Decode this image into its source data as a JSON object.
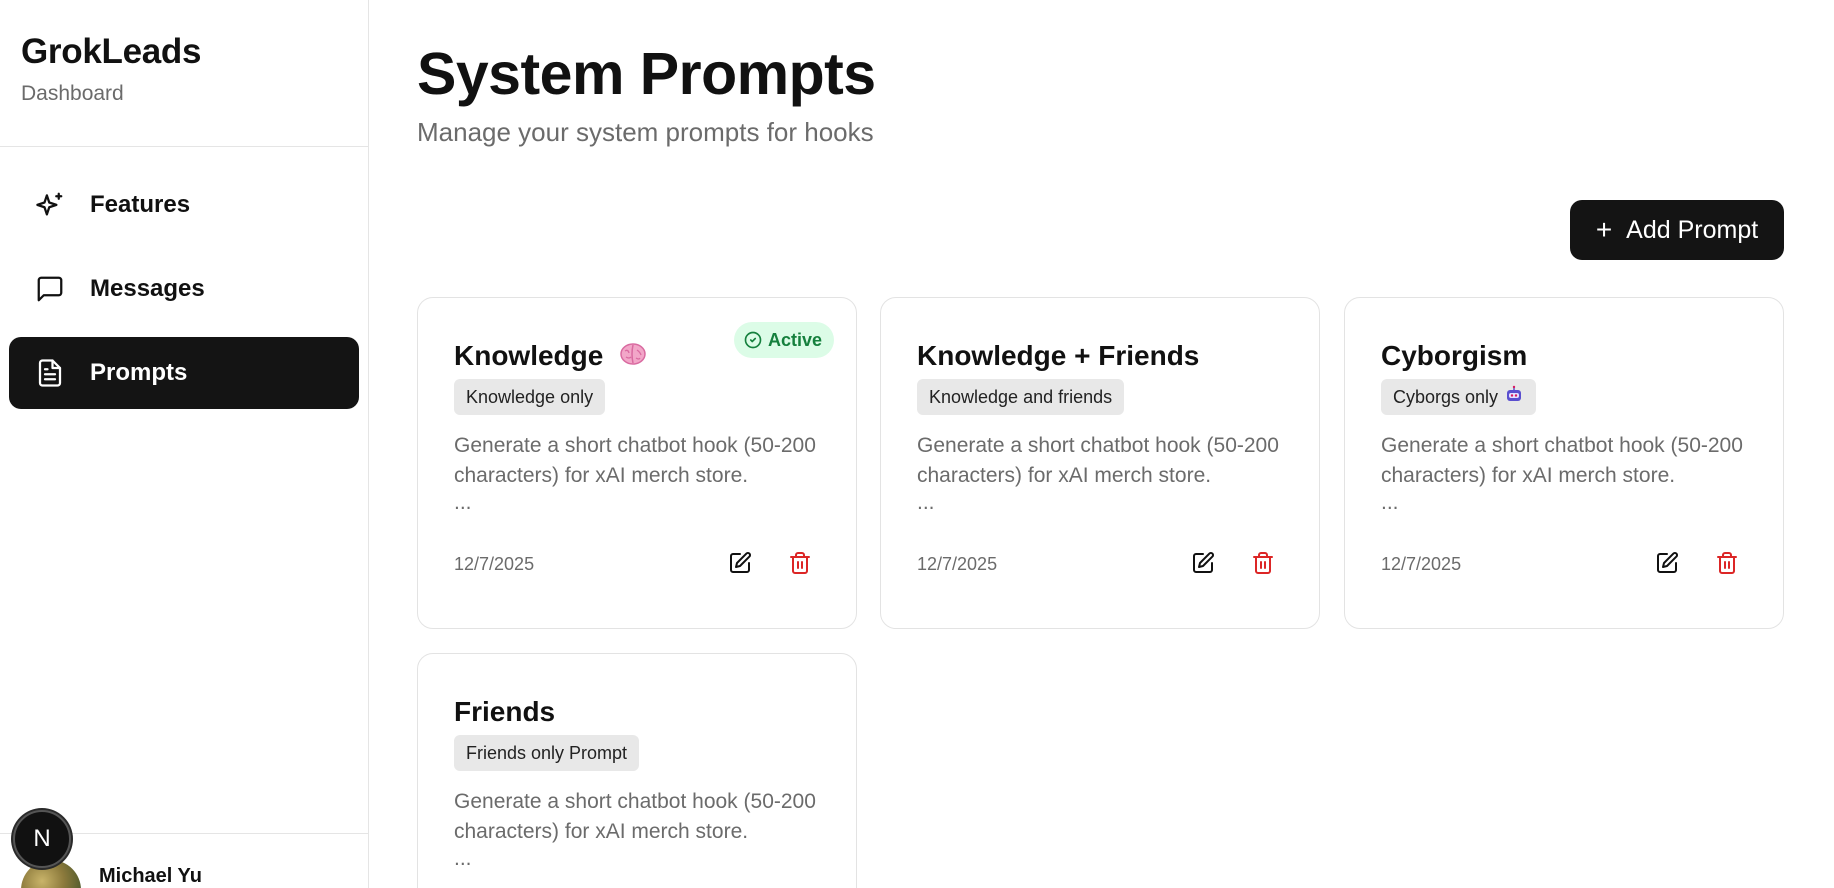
{
  "sidebar": {
    "brand_title": "GrokLeads",
    "brand_subtitle": "Dashboard",
    "items": [
      {
        "label": "Features",
        "icon": "sparkles-icon",
        "active": false
      },
      {
        "label": "Messages",
        "icon": "message-square-icon",
        "active": false
      },
      {
        "label": "Prompts",
        "icon": "file-text-icon",
        "active": true
      }
    ],
    "user": {
      "name": "Michael Yu"
    },
    "dev_badge": "N"
  },
  "main": {
    "title": "System Prompts",
    "subtitle": "Manage your system prompts for hooks",
    "add_button_label": "Add Prompt"
  },
  "cards": [
    {
      "title": "Knowledge",
      "emoji_icon": "brain-icon",
      "tag": "Knowledge only",
      "tag_icon": null,
      "description": "Generate a short chatbot hook (50-200 characters) for xAI merch store.",
      "ellipsis": "...",
      "date": "12/7/2025",
      "active": true,
      "active_label": "Active"
    },
    {
      "title": "Knowledge + Friends",
      "emoji_icon": null,
      "tag": "Knowledge and friends",
      "tag_icon": null,
      "description": "Generate a short chatbot hook (50-200 characters) for xAI merch store.",
      "ellipsis": "...",
      "date": "12/7/2025",
      "active": false
    },
    {
      "title": "Cyborgism",
      "emoji_icon": null,
      "tag": "Cyborgs only",
      "tag_icon": "robot-icon",
      "description": "Generate a short chatbot hook (50-200 characters) for xAI merch store.",
      "ellipsis": "...",
      "date": "12/7/2025",
      "active": false
    },
    {
      "title": "Friends",
      "emoji_icon": null,
      "tag": "Friends only Prompt",
      "tag_icon": null,
      "description": "Generate a short chatbot hook (50-200 characters) for xAI merch store.",
      "ellipsis": "...",
      "date": "",
      "active": false
    }
  ],
  "colors": {
    "primary": "#141414",
    "active_bg": "#dcfce7",
    "active_text": "#15803d",
    "delete": "#dc2626",
    "muted_text": "#6b6b6b",
    "tag_bg": "#e8e8e8"
  }
}
